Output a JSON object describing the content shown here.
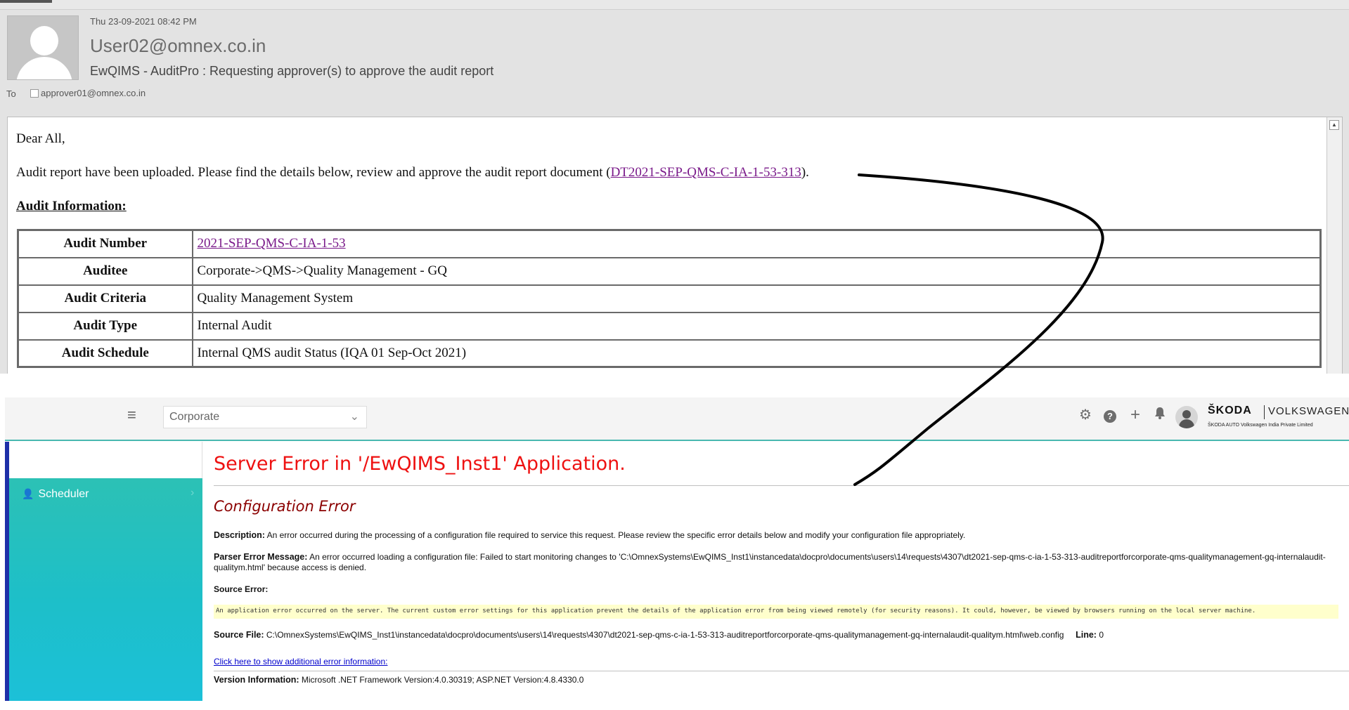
{
  "email": {
    "date": "Thu 23-09-2021 08:42 PM",
    "from": "User02@omnex.co.in",
    "subject": "EwQIMS - AuditPro : Requesting approver(s) to approve the audit report",
    "to_label": "To",
    "to_address": "approver01@omnex.co.in",
    "greeting": "Dear All,",
    "message_prefix": "Audit report have been uploaded. Please find the details below, review and approve the audit report document (",
    "message_link": "DT2021-SEP-QMS-C-IA-1-53-313",
    "message_suffix": ").",
    "section_heading": "Audit Information:",
    "table": [
      {
        "label": "Audit Number",
        "value": "2021-SEP-QMS-C-IA-1-53",
        "is_link": true
      },
      {
        "label": "Auditee",
        "value": "Corporate->QMS->Quality Management - GQ",
        "is_link": false
      },
      {
        "label": "Audit Criteria",
        "value": "Quality Management System",
        "is_link": false
      },
      {
        "label": "Audit Type",
        "value": "Internal Audit",
        "is_link": false
      },
      {
        "label": "Audit Schedule",
        "value": "Internal QMS audit Status (IQA 01 Sep-Oct 2021)",
        "is_link": false
      }
    ]
  },
  "app": {
    "company_select": "Corporate",
    "brand_primary": "ŠKODA",
    "brand_secondary": "VOLKSWAGEN",
    "brand_subtitle": "ŠKODA AUTO Volkswagen India Private Limited",
    "header_icons": [
      "gear-icon",
      "help-icon",
      "plus-icon",
      "bell-icon"
    ],
    "sidebar": {
      "items": [
        {
          "label": "Scheduler",
          "icon": "user-clock-icon"
        }
      ]
    },
    "accent_color": "#49b8b0",
    "error": {
      "title": "Server Error in '/EwQIMS_Inst1' Application.",
      "subtitle": "Configuration Error",
      "description_label": "Description:",
      "description": "An error occurred during the processing of a configuration file required to service this request. Please review the specific error details below and modify your configuration file appropriately.",
      "parser_label": "Parser Error Message:",
      "parser_message": "An error occurred loading a configuration file: Failed to start monitoring changes to 'C:\\OmnexSystems\\EwQIMS_Inst1\\instancedata\\docpro\\documents\\users\\14\\requests\\4307\\dt2021-sep-qms-c-ia-1-53-313-auditreportforcorporate-qms-qualitymanagement-gq-internalaudit-qualitym.html' because access is denied.",
      "source_error_label": "Source Error:",
      "source_error_text": "An application error occurred on the server. The current custom error settings for this application prevent the details of the application error from being viewed remotely (for security reasons). It could, however, be viewed by browsers running on the local server machine.",
      "source_file_label": "Source File:",
      "source_file": "C:\\OmnexSystems\\EwQIMS_Inst1\\instancedata\\docpro\\documents\\users\\14\\requests\\4307\\dt2021-sep-qms-c-ia-1-53-313-auditreportforcorporate-qms-qualitymanagement-gq-internalaudit-qualitym.html\\web.config",
      "line_label": "Line:",
      "line_value": "0",
      "more_info_link": "Click here to show additional error information:",
      "version_label": "Version Information:",
      "version_text": "Microsoft .NET Framework Version:4.0.30319; ASP.NET Version:4.8.4330.0"
    }
  }
}
